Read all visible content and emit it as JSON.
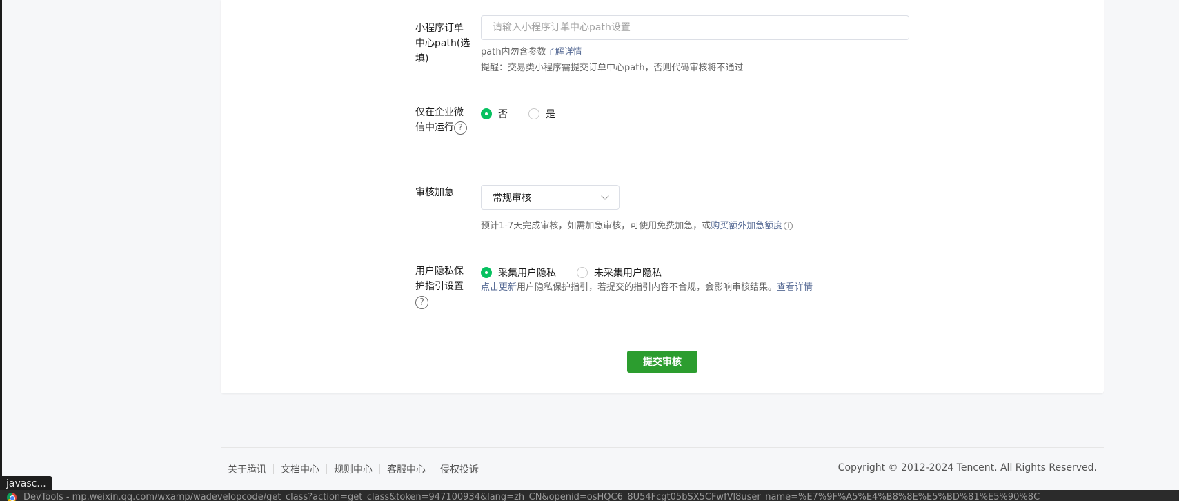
{
  "form": {
    "order_path": {
      "label": "小程序订单中心path(选填)",
      "placeholder": "请输入小程序订单中心path设置",
      "tip_prefix": "path内勿含参数",
      "tip_link": "了解详情",
      "reminder": "提醒：交易类小程序需提交订单中心path，否则代码审核将不通过"
    },
    "wecom_only": {
      "label": "仅在企业微信中运行",
      "help_icon": "?",
      "options": [
        {
          "label": "否",
          "checked": true
        },
        {
          "label": "是",
          "checked": false
        }
      ]
    },
    "expedite": {
      "label": "审核加急",
      "selected": "常规审核",
      "tip_prefix": "预计1-7天完成审核，如需加急审核，可使用免费加急，或",
      "tip_link": "购买额外加急额度",
      "info_icon": "i"
    },
    "privacy": {
      "label": "用户隐私保护指引设置",
      "help_icon": "?",
      "options": [
        {
          "label": "采集用户隐私",
          "checked": true
        },
        {
          "label": "未采集用户隐私",
          "checked": false
        }
      ],
      "update_link": "点击更新",
      "tip_middle": "用户隐私保护指引，若提交的指引内容不合规，会影响审核结果。",
      "detail_link": "查看详情"
    },
    "submit_label": "提交审核"
  },
  "footer": {
    "links": [
      "关于腾讯",
      "文档中心",
      "规则中心",
      "客服中心",
      "侵权投诉"
    ],
    "copyright": "Copyright © 2012-2024 Tencent. All Rights Reserved."
  },
  "browser": {
    "tooltip": "javasc...",
    "status_url": "DevTools - mp.weixin.qq.com/wxamp/wadevelopcode/get_class?action=get_class&token=947100934&lang=zh_CN&openid=osHQC6_8U54Fcgt05bSX5CFwfVl8user_name=%E7%9F%A5%E4%B8%8E%E5%BD%81%E5%90%8C"
  },
  "colors": {
    "brand_green": "#07c160",
    "button_green": "#2c9d2f",
    "link_blue": "#576b95"
  }
}
